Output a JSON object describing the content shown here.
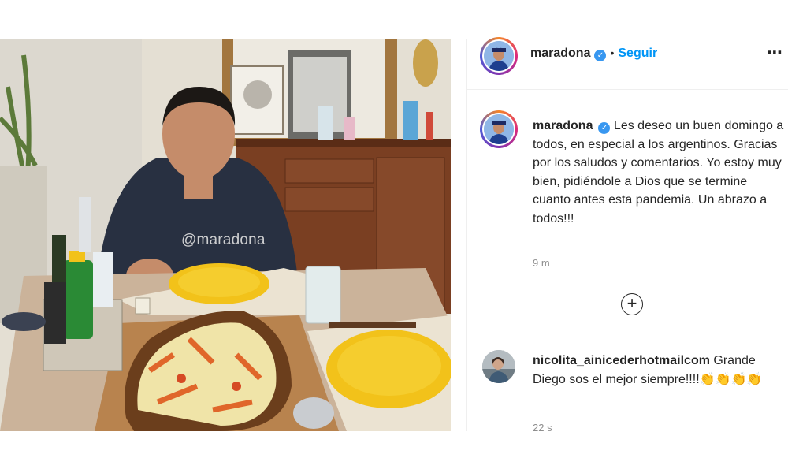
{
  "post": {
    "watermark": "@maradona"
  },
  "header": {
    "username": "maradona",
    "verified_glyph": "✓",
    "separator": "•",
    "follow_label": "Seguir",
    "more_icon": "⋯"
  },
  "caption": {
    "username": "maradona",
    "text": "Les deseo un buen domingo a todos, en especial a los argentinos. Gracias por los saludos y comentarios. Yo estoy muy bien, pidiéndole a Dios que se termine cuanto antes esta pandemia. Un abrazo a todos!!!",
    "time": "9 m"
  },
  "load_more": {
    "icon": "+"
  },
  "comment": {
    "username": "nicolita_ainicederhotmailcom",
    "text": "Grande Diego sos el mejor siempre!!!!👏👏👏👏",
    "time": "22 s"
  },
  "colors": {
    "link_blue": "#0095f6",
    "verified_blue": "#3897f0",
    "muted": "#8e8e8e",
    "plate_yellow": "#f2c21a"
  }
}
